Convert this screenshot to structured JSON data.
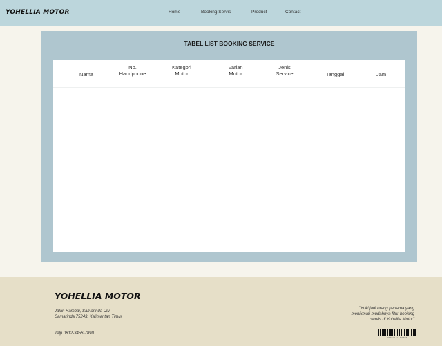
{
  "header": {
    "brand": "YOHELLIA MOTOR",
    "nav": [
      "Home",
      "Booking Servis",
      "Product",
      "Contact"
    ]
  },
  "main": {
    "title": "TABEL LIST BOOKING SERVICE",
    "columns": [
      "Nama",
      "No.\nHandphone",
      "Kategori\nMotor",
      "Varian\nMotor",
      "Jenis\nService",
      "Tanggal",
      "Jam"
    ],
    "rows": []
  },
  "footer": {
    "brand": "YOHELLIA MOTOR",
    "address": "Jalan Rambai, Samarinda Ulu\nSamarinda 75243, Kalimantan Timur",
    "phone": "Telp 0812-3456-7890",
    "quote": "\"Yuk! jadi orang pertama yang\nmenikmati mudahnya fitur booking\nservis di Yohellia Motor\"",
    "barcode_text": "YOHELLIA MOTOR"
  },
  "colors": {
    "navbar": "#bcd6dc",
    "panel": "#afc6cf",
    "footer": "#e6dfc8",
    "page": "#f6f4ec"
  }
}
